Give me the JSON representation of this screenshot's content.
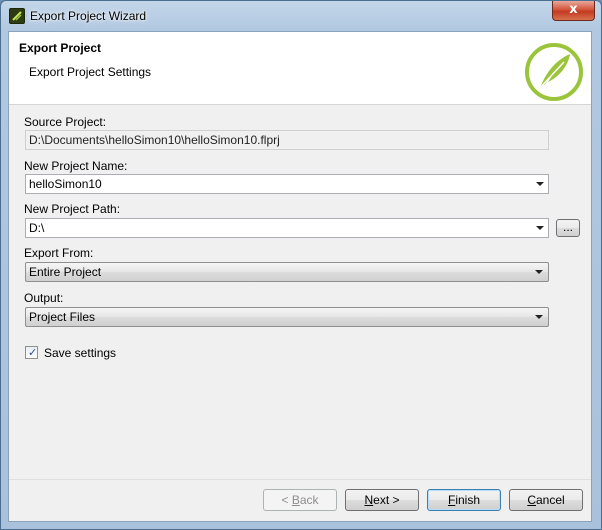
{
  "window": {
    "title": "Export Project Wizard",
    "close_glyph": "x"
  },
  "header": {
    "title": "Export Project",
    "subtitle": "Export Project Settings"
  },
  "form": {
    "source_project": {
      "label": "Source Project:",
      "value": "D:\\Documents\\helloSimon10\\helloSimon10.flprj"
    },
    "new_project_name": {
      "label": "New Project Name:",
      "value": "helloSimon10"
    },
    "new_project_path": {
      "label": "New Project Path:",
      "value": "D:\\",
      "browse_label": "..."
    },
    "export_from": {
      "label": "Export From:",
      "value": "Entire Project"
    },
    "output": {
      "label": "Output:",
      "value": "Project Files"
    },
    "save_settings": {
      "label": "Save settings",
      "checked": true
    }
  },
  "buttons": {
    "back": {
      "lt": "< ",
      "key": "B",
      "rest": "ack"
    },
    "next": {
      "key": "N",
      "rest": "ext >"
    },
    "finish": {
      "key": "F",
      "rest": "inish"
    },
    "cancel": {
      "key": "C",
      "rest": "ancel"
    }
  },
  "colors": {
    "logo_green": "#9ac53b",
    "accent_border": "#3c7fb1"
  },
  "icons": [
    "app-icon",
    "close-icon",
    "feather-logo-icon",
    "dropdown-arrow-icon",
    "checkmark-icon"
  ]
}
